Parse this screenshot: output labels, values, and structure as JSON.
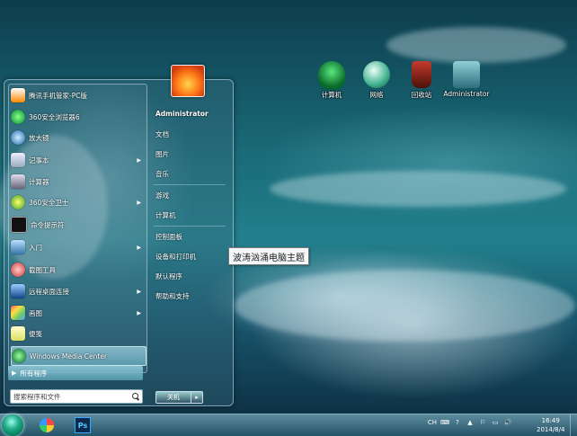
{
  "desktop": {
    "icons": [
      {
        "label": "计算机",
        "icon": "computer-icon"
      },
      {
        "label": "网络",
        "icon": "network-icon"
      },
      {
        "label": "回收站",
        "icon": "recycle-bin-icon"
      },
      {
        "label": "Administrator",
        "icon": "user-folder-icon"
      }
    ]
  },
  "start_menu": {
    "programs": [
      {
        "label": "腾讯手机管家-PC版",
        "icon": "tencent-icon"
      },
      {
        "label": "360安全浏览器6",
        "icon": "360-browser-icon"
      },
      {
        "label": "放大镜",
        "icon": "magnifier-icon"
      },
      {
        "label": "记事本",
        "icon": "notepad-icon",
        "has_submenu": true
      },
      {
        "label": "计算器",
        "icon": "calculator-icon"
      },
      {
        "label": "360安全卫士",
        "icon": "360-safe-icon",
        "has_submenu": true
      },
      {
        "label": "命令提示符",
        "icon": "cmd-icon"
      },
      {
        "label": "入门",
        "icon": "getting-started-icon",
        "has_submenu": true
      },
      {
        "label": "截图工具",
        "icon": "snipping-tool-icon"
      },
      {
        "label": "远程桌面连接",
        "icon": "remote-desktop-icon",
        "has_submenu": true
      },
      {
        "label": "画图",
        "icon": "paint-icon",
        "has_submenu": true
      },
      {
        "label": "便笺",
        "icon": "sticky-notes-icon"
      },
      {
        "label": "Windows Media Center",
        "icon": "media-center-icon"
      }
    ],
    "all_programs": "所有程序",
    "search_placeholder": "搜索程序和文件",
    "user_name": "Administrator",
    "places": [
      {
        "label": "文档"
      },
      {
        "label": "图片"
      },
      {
        "label": "音乐"
      },
      {
        "label": "游戏"
      },
      {
        "label": "计算机"
      },
      {
        "label": "控制面板"
      },
      {
        "label": "设备和打印机"
      },
      {
        "label": "默认程序"
      },
      {
        "label": "帮助和支持"
      }
    ],
    "shutdown_label": "关机",
    "shutdown_more": "▸"
  },
  "tooltip": "波涛汹涌电脑主题",
  "taskbar": {
    "tray": [
      "CH",
      "⌨",
      "?",
      "▲",
      "⚐",
      "▭",
      "🔊"
    ],
    "clock_time": "16:49",
    "clock_date": "2014/8/4"
  },
  "colors": {
    "accent": "#3a8fa8",
    "tooltip_bg": "#f4f6f8"
  }
}
